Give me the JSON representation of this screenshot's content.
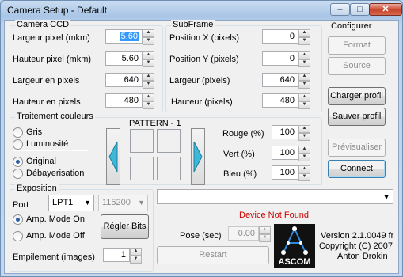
{
  "window": {
    "title": "Camera Setup - Default"
  },
  "camera_ccd": {
    "title": "Caméra CCD",
    "fields": [
      {
        "label": "Largeur pixel (mkm)",
        "value": "5.60"
      },
      {
        "label": "Hauteur pixel (mkm)",
        "value": "5.60"
      },
      {
        "label": "Largeur en pixels",
        "value": "640"
      },
      {
        "label": "Hauteur en pixels",
        "value": "480"
      }
    ]
  },
  "subframe": {
    "title": "SubFrame",
    "fields": [
      {
        "label": "Position X (pixels)",
        "value": "0"
      },
      {
        "label": "Position Y (pixels)",
        "value": "0"
      },
      {
        "label": "Largeur (pixels)",
        "value": "640"
      },
      {
        "label": "Hauteur (pixels)",
        "value": "480"
      }
    ]
  },
  "configurer": {
    "title": "Configurer",
    "format": "Format",
    "source": "Source",
    "charger": "Charger profil",
    "sauver": "Sauver profil",
    "previsualiser": "Prévisualiser",
    "connect": "Connect"
  },
  "traitement": {
    "title": "Traitement couleurs",
    "gris": "Gris",
    "luminosite": "Luminosité",
    "original": "Original",
    "debayer": "Débayerisation",
    "pattern": "PATTERN - 1",
    "rouge": {
      "label": "Rouge (%)",
      "value": "100"
    },
    "vert": {
      "label": "Vert (%)",
      "value": "100"
    },
    "bleu": {
      "label": "Bleu (%)",
      "value": "100"
    }
  },
  "exposition": {
    "title": "Exposition",
    "port_label": "Port",
    "port_value": "LPT1",
    "baud_value": "115200",
    "amp_on": "Amp. Mode On",
    "amp_off": "Amp. Mode Off",
    "regler": "Régler Bits",
    "empilement_label": "Empilement (images)",
    "empilement_value": "1"
  },
  "status": {
    "text": "Device Not Found",
    "color": "#cc0000"
  },
  "pose": {
    "label": "Pose (sec)",
    "value": "0.00"
  },
  "restart": "Restart",
  "logo": {
    "text": "ASCOM"
  },
  "about": {
    "version": "Version 2.1.0049 fr",
    "copyright": "Copyright (C) 2007",
    "author": "Anton Drokin"
  }
}
